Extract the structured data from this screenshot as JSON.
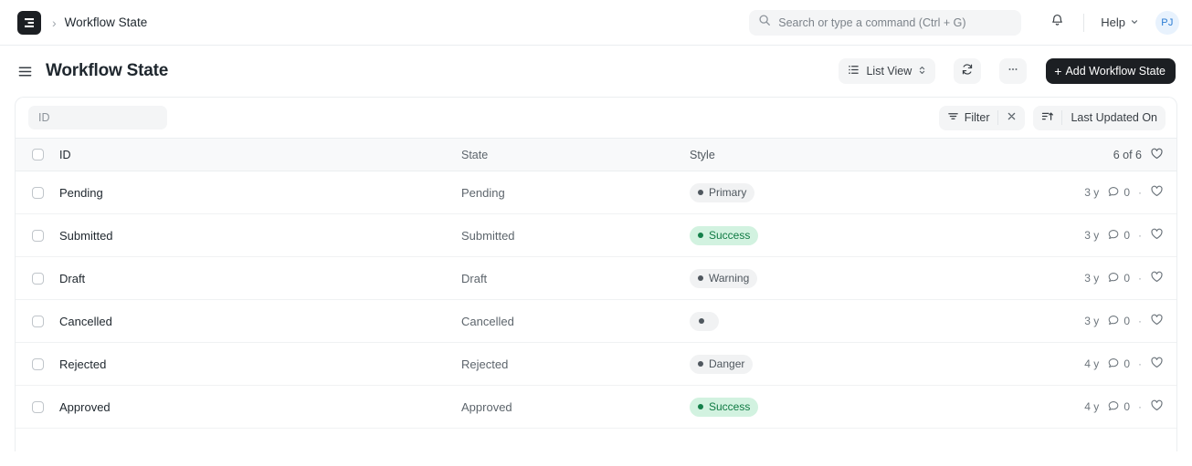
{
  "navbar": {
    "logo_icon": "frappe-logo-icon",
    "breadcrumb_separator": "›",
    "breadcrumb": "Workflow State",
    "search": {
      "icon": "search-icon",
      "placeholder": "Search or type a command (Ctrl + G)",
      "value": ""
    },
    "notifications_icon": "bell-icon",
    "help_label": "Help",
    "help_chevron_icon": "chevron-down-icon",
    "avatar_initials": "PJ",
    "avatar_bg": "#e8f2fd",
    "avatar_color": "#2b7cd3"
  },
  "pagehead": {
    "menu_icon": "hamburger-menu-icon",
    "title": "Workflow State",
    "view_switcher": {
      "icon": "list-view-icon",
      "label": "List View",
      "chevron_icon": "chevron-up-down-icon"
    },
    "refresh_icon": "refresh-icon",
    "more_icon": "ellipsis-icon",
    "add_button": {
      "plus": "+",
      "label": "Add Workflow State"
    }
  },
  "filter_bar": {
    "id_input": {
      "placeholder": "ID",
      "value": ""
    },
    "filter": {
      "icon": "filter-icon",
      "label": "Filter",
      "clear_icon": "close-icon"
    },
    "sort": {
      "icon": "sort-ascending-icon",
      "label": "Last Updated On"
    }
  },
  "table": {
    "columns": {
      "id": "ID",
      "state": "State",
      "style": "Style"
    },
    "count_label": "6 of 6",
    "like_icon": "heart-icon",
    "select_all_checkbox": "checkbox",
    "rows": [
      {
        "id": "Pending",
        "state": "Pending",
        "style_label": "Primary",
        "style_variant": "gray",
        "modified": "3 y",
        "comments": "0",
        "separator": "·"
      },
      {
        "id": "Submitted",
        "state": "Submitted",
        "style_label": "Success",
        "style_variant": "green",
        "modified": "3 y",
        "comments": "0",
        "separator": "·"
      },
      {
        "id": "Draft",
        "state": "Draft",
        "style_label": "Warning",
        "style_variant": "gray",
        "modified": "3 y",
        "comments": "0",
        "separator": "·"
      },
      {
        "id": "Cancelled",
        "state": "Cancelled",
        "style_label": "",
        "style_variant": "empty",
        "modified": "3 y",
        "comments": "0",
        "separator": "·"
      },
      {
        "id": "Rejected",
        "state": "Rejected",
        "style_label": "Danger",
        "style_variant": "gray",
        "modified": "4 y",
        "comments": "0",
        "separator": "·"
      },
      {
        "id": "Approved",
        "state": "Approved",
        "style_label": "Success",
        "style_variant": "green",
        "modified": "4 y",
        "comments": "0",
        "separator": "·"
      }
    ]
  },
  "colors": {
    "primary_button_bg": "#1c1f23",
    "success_badge_bg": "#d2f2e0",
    "success_badge_text": "#0f7a43",
    "gray_badge_bg": "#f1f2f3",
    "border": "#ebeef0"
  }
}
